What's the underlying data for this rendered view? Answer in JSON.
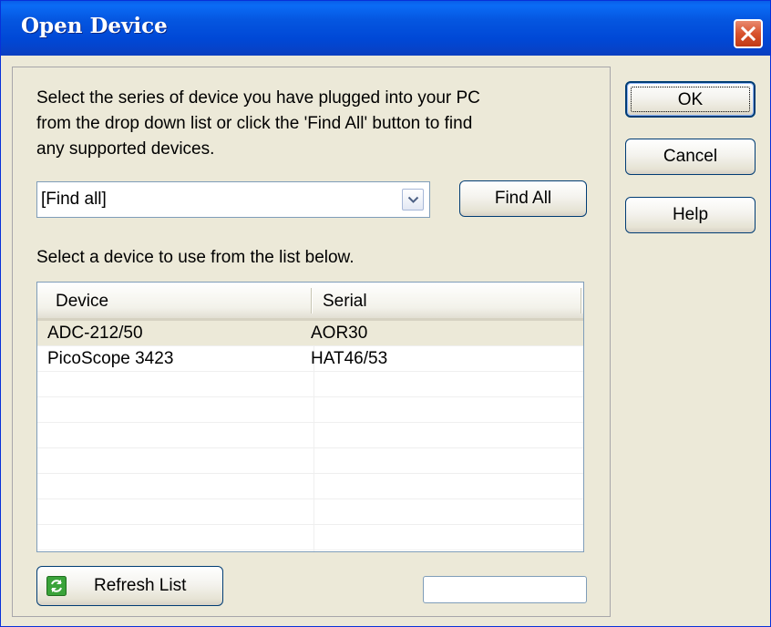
{
  "window": {
    "title": "Open Device"
  },
  "dialog": {
    "prompt_lines": [
      "Select the series of device you have plugged into your PC",
      "from the drop down list or click the 'Find All' button to find",
      "any supported devices."
    ],
    "series_select": {
      "value": "[Find all]"
    },
    "find_all_label": "Find All",
    "list_label": "Select a device to use from the list below.",
    "table": {
      "columns": [
        "Device",
        "Serial"
      ],
      "rows": [
        {
          "device": "ADC-212/50",
          "serial": "AOR30",
          "selected": true
        },
        {
          "device": "PicoScope 3423",
          "serial": "HAT46/53",
          "selected": false
        }
      ]
    },
    "refresh_label": "Refresh List",
    "status_value": ""
  },
  "buttons": {
    "ok": "OK",
    "cancel": "Cancel",
    "help": "Help"
  },
  "colors": {
    "titlebar": "#0054e3",
    "close": "#d8522d",
    "face": "#ece9d8",
    "selected_row": "#ece9d8"
  },
  "icons": {
    "close": "close-icon",
    "dropdown": "chevron-down-icon",
    "refresh": "refresh-icon"
  }
}
